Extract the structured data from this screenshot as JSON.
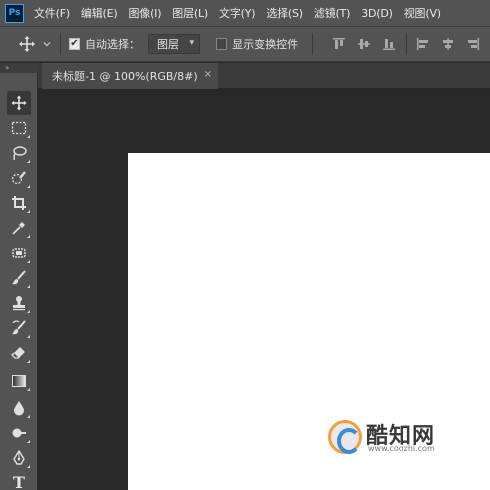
{
  "app": {
    "logo": "Ps"
  },
  "menu": [
    "文件(F)",
    "编辑(E)",
    "图像(I)",
    "图层(L)",
    "文字(Y)",
    "选择(S)",
    "滤镜(T)",
    "3D(D)",
    "视图(V)"
  ],
  "options": {
    "auto_select_label": "自动选择：",
    "auto_select_checked": true,
    "auto_select_target": "图层",
    "show_transform_label": "显示变换控件",
    "show_transform_checked": false
  },
  "panel_collapse": "»",
  "document_tab": {
    "title": "未标题-1 @ 100%(RGB/8#)",
    "close": "×"
  },
  "watermark": {
    "text": "酷知网",
    "url": "www.coozhi.com"
  },
  "tools": [
    {
      "name": "move-tool",
      "icon": "move-icon",
      "active": true
    },
    {
      "name": "marquee-tool",
      "icon": "rect-marquee-icon"
    },
    {
      "name": "lasso-tool",
      "icon": "lasso-icon"
    },
    {
      "name": "quick-select-tool",
      "icon": "quick-select-icon"
    },
    {
      "name": "crop-tool",
      "icon": "crop-icon"
    },
    {
      "name": "eyedropper-tool",
      "icon": "eyedropper-icon"
    },
    {
      "name": "healing-tool",
      "icon": "healing-brush-icon"
    },
    {
      "name": "brush-tool",
      "icon": "brush-icon"
    },
    {
      "name": "stamp-tool",
      "icon": "clone-stamp-icon"
    },
    {
      "name": "history-brush-tool",
      "icon": "history-brush-icon"
    },
    {
      "name": "eraser-tool",
      "icon": "eraser-icon"
    },
    {
      "name": "gradient-tool",
      "icon": "gradient-icon"
    },
    {
      "name": "blur-tool",
      "icon": "blur-drop-icon"
    },
    {
      "name": "dodge-tool",
      "icon": "dodge-icon"
    },
    {
      "name": "pen-tool",
      "icon": "pen-icon"
    },
    {
      "name": "type-tool",
      "icon": "type-icon",
      "glyph": "T"
    }
  ]
}
